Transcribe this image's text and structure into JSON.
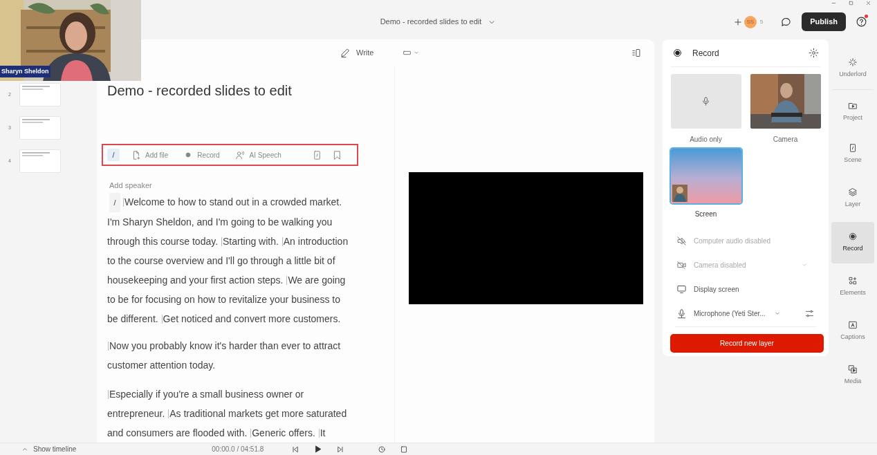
{
  "header": {
    "title": "Demo - recorded slides to edit",
    "avatar": "SS",
    "collaborators": "5",
    "publish": "Publish"
  },
  "webcam": {
    "kind": "picture",
    "name": "Sharyn Sheldon"
  },
  "slides": [
    {
      "number": "2",
      "selected": false
    },
    {
      "number": "3",
      "selected": false
    },
    {
      "number": "4",
      "selected": false
    }
  ],
  "editor": {
    "write": "Write",
    "doc_title": "Demo - recorded slides to edit",
    "toolbar": [
      {
        "kind": "slash",
        "label": "/"
      },
      {
        "kind": "file",
        "label": "Add file"
      },
      {
        "kind": "record",
        "label": "Record"
      },
      {
        "kind": "speech",
        "label": "AI Speech"
      },
      {
        "kind": "scene"
      },
      {
        "kind": "bookmark"
      }
    ],
    "speaker": "Add speaker",
    "paragraphs": [
      {
        "marker": "/",
        "segments": [
          "Welcome to how to stand out in a crowded market. I'm Sharyn Sheldon, and I'm going to be walking you through this course today.",
          "Starting with.",
          "An introduction to the course overview and I'll go through a little bit of housekeeping and your first action steps.",
          "We are going to be for focusing on how to revitalize your business to be different.",
          "Get noticed and convert more customers."
        ]
      },
      {
        "segments": [
          "Now you probably know it's harder than ever to attract customer attention today."
        ]
      },
      {
        "segments": [
          "Especially if you're a small business owner or entrepreneur.",
          "As traditional markets get more saturated and consumers are flooded with.",
          "Generic offers.",
          "It"
        ]
      }
    ]
  },
  "record_panel": {
    "title": "Record",
    "sources": [
      {
        "kind": "audio",
        "label": "Audio only",
        "selected": false
      },
      {
        "kind": "camera",
        "label": "Camera",
        "selected": false
      },
      {
        "kind": "screen",
        "label": "Screen",
        "selected": true
      }
    ],
    "options": [
      {
        "kind": "computer-audio",
        "label": "Computer audio disabled",
        "disabled": true
      },
      {
        "kind": "camera",
        "label": "Camera disabled",
        "disabled": true,
        "dropdown": true
      },
      {
        "kind": "display",
        "label": "Display screen",
        "disabled": false
      },
      {
        "kind": "microphone",
        "label": "Microphone (Yeti Ster...",
        "disabled": false,
        "dropdown": true,
        "settings": true
      }
    ],
    "button": "Record new layer"
  },
  "rail": [
    {
      "kind": "underlord",
      "label": "Underlord",
      "selected": false
    },
    {
      "kind": "project",
      "label": "Project",
      "selected": false
    },
    {
      "kind": "scene",
      "label": "Scene",
      "selected": false
    },
    {
      "kind": "layer",
      "label": "Layer",
      "selected": false
    },
    {
      "kind": "record",
      "label": "Record",
      "selected": true
    },
    {
      "kind": "elements",
      "label": "Elements",
      "selected": false
    },
    {
      "kind": "captions",
      "label": "Captions",
      "selected": false
    },
    {
      "kind": "media",
      "label": "Media",
      "selected": false
    }
  ],
  "bottom_bar": {
    "show_timeline": "Show timeline",
    "time": "00:00.0 / 04:51.8"
  }
}
